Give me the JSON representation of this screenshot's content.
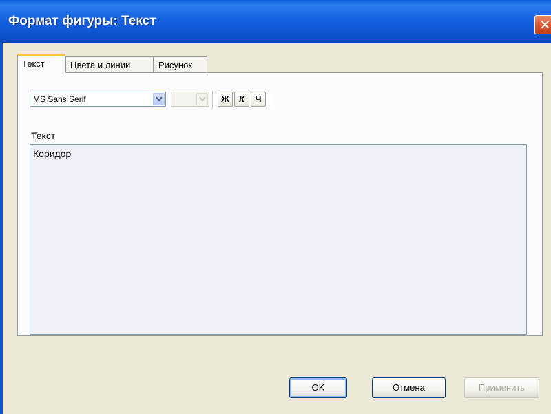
{
  "window": {
    "title": "Формат фигуры: Текст",
    "close_symbol": "✕"
  },
  "tabs": [
    {
      "label": "Текст",
      "active": true
    },
    {
      "label": "Цвета и линии",
      "active": false
    },
    {
      "label": "Рисунок",
      "active": false
    }
  ],
  "toolbar": {
    "font_value": "MS Sans Serif",
    "size_value": "",
    "bold_label": "Ж",
    "italic_label": "К",
    "underline_label": "Ч"
  },
  "text_section": {
    "label": "Текст",
    "value": "Коридор"
  },
  "buttons": {
    "ok": "OK",
    "cancel": "Отмена",
    "apply": "Применить"
  },
  "colors": {
    "title_bar": "#0d52cf",
    "dialog_bg": "#ece9d8",
    "tab_highlight": "#ffc83c"
  }
}
